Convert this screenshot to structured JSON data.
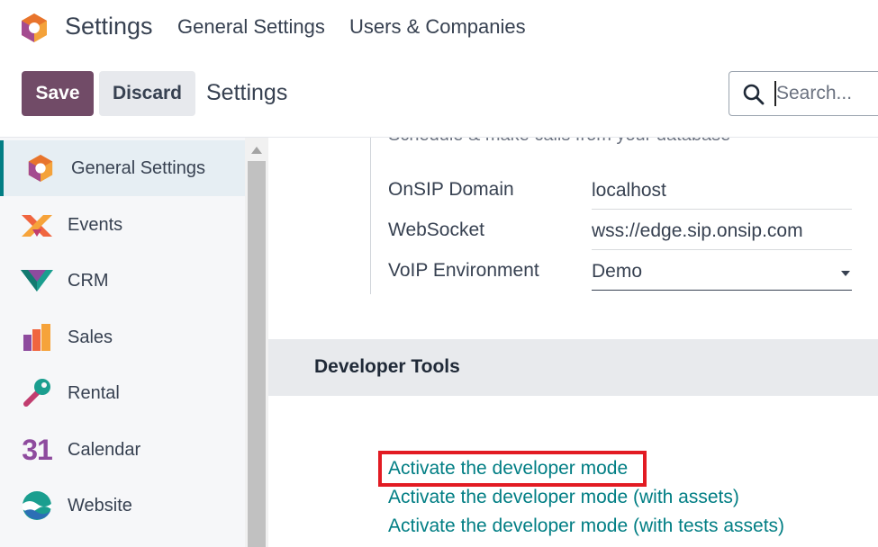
{
  "navbar": {
    "app_title": "Settings",
    "menu": [
      "General Settings",
      "Users & Companies"
    ]
  },
  "control_panel": {
    "save_label": "Save",
    "discard_label": "Discard",
    "breadcrumb": "Settings",
    "search_placeholder": "Search..."
  },
  "sidebar": {
    "items": [
      {
        "label": "General Settings",
        "icon": "odoo-logo-icon",
        "active": true
      },
      {
        "label": "Events",
        "icon": "events-icon"
      },
      {
        "label": "CRM",
        "icon": "crm-icon"
      },
      {
        "label": "Sales",
        "icon": "sales-icon"
      },
      {
        "label": "Rental",
        "icon": "rental-key-icon"
      },
      {
        "label": "Calendar",
        "icon": "calendar-icon",
        "glyph": "31"
      },
      {
        "label": "Website",
        "icon": "website-icon"
      }
    ]
  },
  "voip": {
    "cut_description": "Schedule & make calls from your database",
    "fields": [
      {
        "label": "OnSIP Domain",
        "value": "localhost"
      },
      {
        "label": "WebSocket",
        "value": "wss://edge.sip.onsip.com"
      },
      {
        "label": "VoIP Environment",
        "value": "Demo"
      }
    ]
  },
  "developer_tools": {
    "title": "Developer Tools",
    "links": [
      "Activate the developer mode",
      "Activate the developer mode (with assets)",
      "Activate the developer mode (with tests assets)"
    ]
  },
  "colors": {
    "brand": "#714b67",
    "link": "#017e84",
    "highlight": "#e21b23"
  }
}
